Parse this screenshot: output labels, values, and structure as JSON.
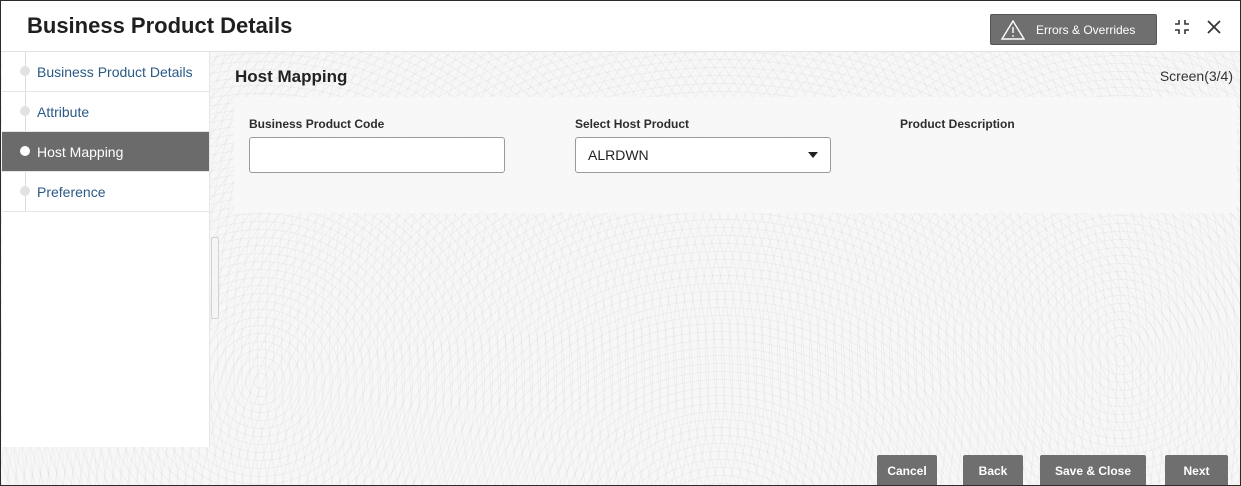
{
  "header": {
    "title": "Business Product Details",
    "errors_button": "Errors & Overrides",
    "icons": [
      "warning-icon",
      "minimize-icon",
      "close-icon"
    ]
  },
  "sidebar": {
    "items": [
      {
        "label": "Business Product Details",
        "active": false
      },
      {
        "label": "Attribute",
        "active": false
      },
      {
        "label": "Host Mapping",
        "active": true
      },
      {
        "label": "Preference",
        "active": false
      }
    ]
  },
  "main": {
    "section_title": "Host Mapping",
    "screen_indicator": "Screen(3/4)",
    "fields": {
      "business_product_code": {
        "label": "Business Product Code",
        "value": ""
      },
      "select_host_product": {
        "label": "Select Host Product",
        "value": "ALRDWN"
      },
      "product_description": {
        "label": "Product Description"
      }
    }
  },
  "footer": {
    "cancel": "Cancel",
    "back": "Back",
    "save_close": "Save & Close",
    "next": "Next"
  },
  "colors": {
    "button_gray": "#6f6f6f",
    "active_step": "#6b6b6b",
    "link_blue": "#2a5a86"
  }
}
